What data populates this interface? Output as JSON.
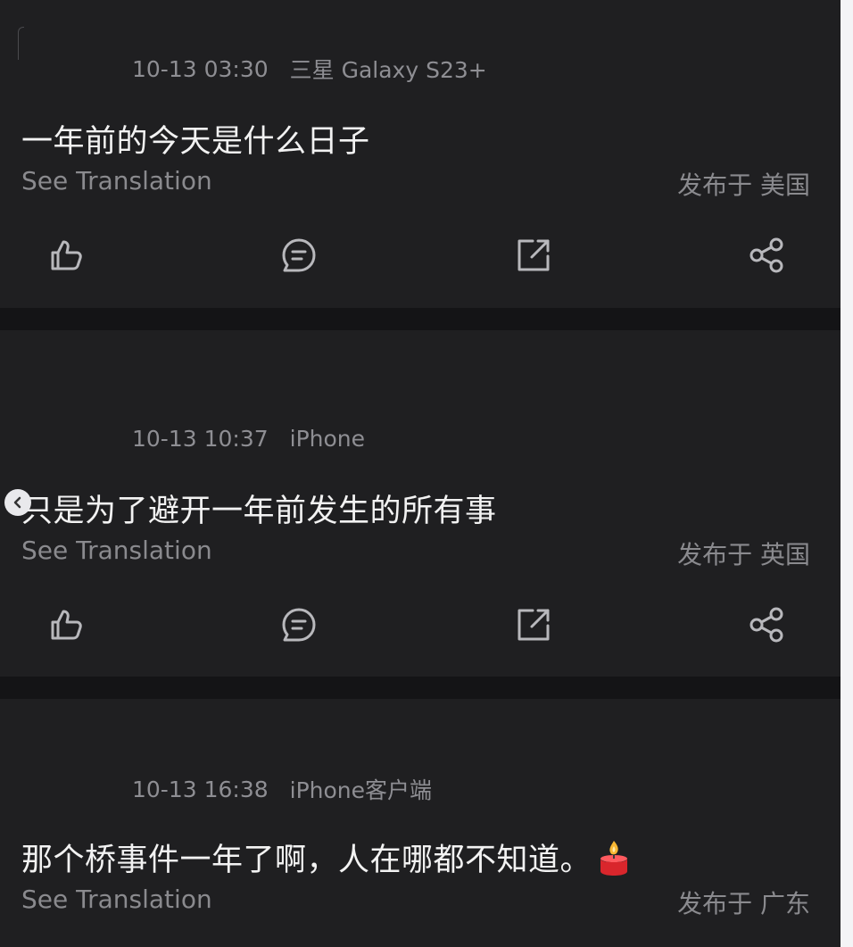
{
  "posts": [
    {
      "timestamp": "10-13 03:30",
      "device": "三星 Galaxy S23+",
      "text": "一年前的今天是什么日子",
      "translate_label": "See Translation",
      "location": "发布于 美国"
    },
    {
      "timestamp": "10-13 10:37",
      "device": "iPhone",
      "text": "只是为了避开一年前发生的所有事",
      "translate_label": "See Translation",
      "location": "发布于 英国"
    },
    {
      "timestamp": "10-13 16:38",
      "device": "iPhone客户端",
      "text": "那个桥事件一年了啊，人在哪都不知道。",
      "translate_label": "See Translation",
      "location": "发布于 广东"
    }
  ],
  "actions": [
    "like-icon",
    "comment-icon",
    "repost-icon",
    "share-icon"
  ],
  "colors": {
    "background": "#141416",
    "card": "#1f1f21",
    "text_primary": "#f2f2f2",
    "text_secondary": "#8e8e93",
    "candle_red": "#d9262c"
  }
}
